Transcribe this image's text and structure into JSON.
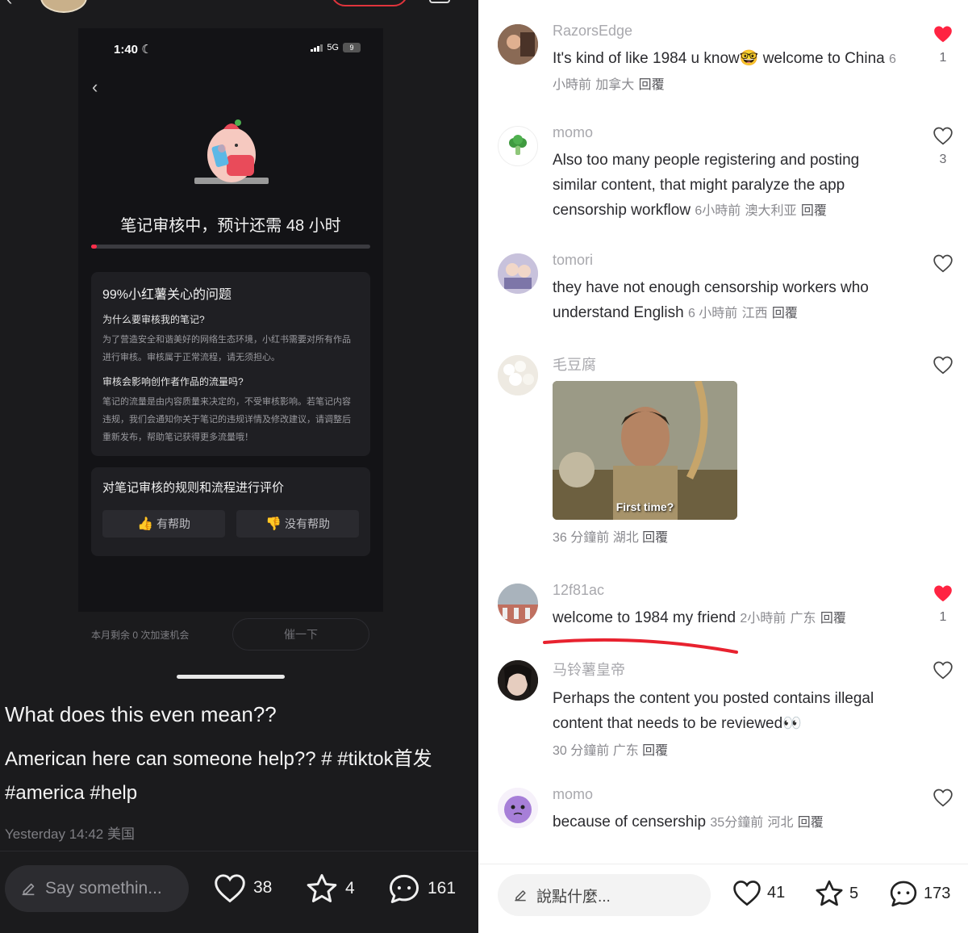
{
  "left": {
    "status_bar": {
      "time": "1:40",
      "network": "5G",
      "battery": "9"
    },
    "review": {
      "title": "笔记审核中，预计还需 48 小时",
      "progress_fraction": 0.02
    },
    "faq": {
      "title": "99%小红薯关心的问题",
      "items": [
        {
          "q": "为什么要审核我的笔记?",
          "a": "为了营造安全和谐美好的网络生态环境，小红书需要对所有作品进行审核。审核属于正常流程，请无须担心。"
        },
        {
          "q": "审核会影响创作者作品的流量吗?",
          "a": "笔记的流量是由内容质量来决定的，不受审核影响。若笔记内容违规，我们会通知你关于笔记的违规详情及修改建议，请调整后重新发布，帮助笔记获得更多流量哦！"
        }
      ]
    },
    "rating": {
      "title": "对笔记审核的规则和流程进行评价",
      "helpful": "有帮助",
      "not_helpful": "没有帮助",
      "helpful_emoji": "👍",
      "not_helpful_emoji": "👎"
    },
    "boost_note": "本月剩余 0 次加速机会",
    "urge_button": "催一下",
    "post": {
      "title": "What does this even mean??",
      "body": "American here can someone help?? #",
      "tags": "#tiktok首发  #america  #help",
      "meta": "Yesterday 14:42 美国"
    },
    "bottom_bar": {
      "input_placeholder": "Say somethin...",
      "likes": "38",
      "stars": "4",
      "comments": "161"
    }
  },
  "right": {
    "comments": [
      {
        "user": "RazorsEdge",
        "text": "It's kind of like 1984 u know🤓 welcome to China",
        "time": "6 小時前",
        "location": "加拿大",
        "reply": "回覆",
        "liked": true,
        "like_count": "1"
      },
      {
        "user": "momo",
        "text": "Also too many people registering and posting similar content, that might paralyze the app censorship workflow",
        "time": "6小時前",
        "location": "澳大利亚",
        "reply": "回覆",
        "liked": false,
        "like_count": "3"
      },
      {
        "user": "tomori",
        "text": "they have not enough censorship workers who understand English",
        "time": "6 小時前",
        "location": "江西",
        "reply": "回覆",
        "liked": false,
        "like_count": ""
      },
      {
        "user": "毛豆腐",
        "gif_caption": "First time?",
        "time": "36 分鐘前",
        "location": "湖北",
        "reply": "回覆",
        "liked": false,
        "like_count": ""
      },
      {
        "user": "12f81ac",
        "text": "welcome to 1984 my friend",
        "time": "2小時前",
        "location": "广东",
        "reply": "回覆",
        "liked": true,
        "like_count": "1"
      },
      {
        "user": "马铃薯皇帝",
        "text": "Perhaps the content you posted contains illegal content that needs to be reviewed👀",
        "time": "30 分鐘前",
        "location": "广东",
        "reply": "回覆",
        "liked": false,
        "like_count": ""
      },
      {
        "user": "momo",
        "text": "because of censership",
        "time": "35分鐘前",
        "location": "河北",
        "reply": "回覆",
        "liked": false,
        "like_count": ""
      }
    ],
    "bottom_bar": {
      "input_placeholder": "說點什麼...",
      "likes": "41",
      "stars": "5",
      "comments": "173"
    }
  },
  "colors": {
    "like_red": "#ff2442",
    "underline_red": "#e8222f",
    "dark_bg": "#1b1b1d"
  },
  "icons": [
    "heart-icon",
    "star-icon",
    "comment-icon",
    "pencil-icon",
    "back-chevron-icon",
    "thumbs-up-icon",
    "thumbs-down-icon",
    "moon-icon",
    "signal-icon"
  ]
}
